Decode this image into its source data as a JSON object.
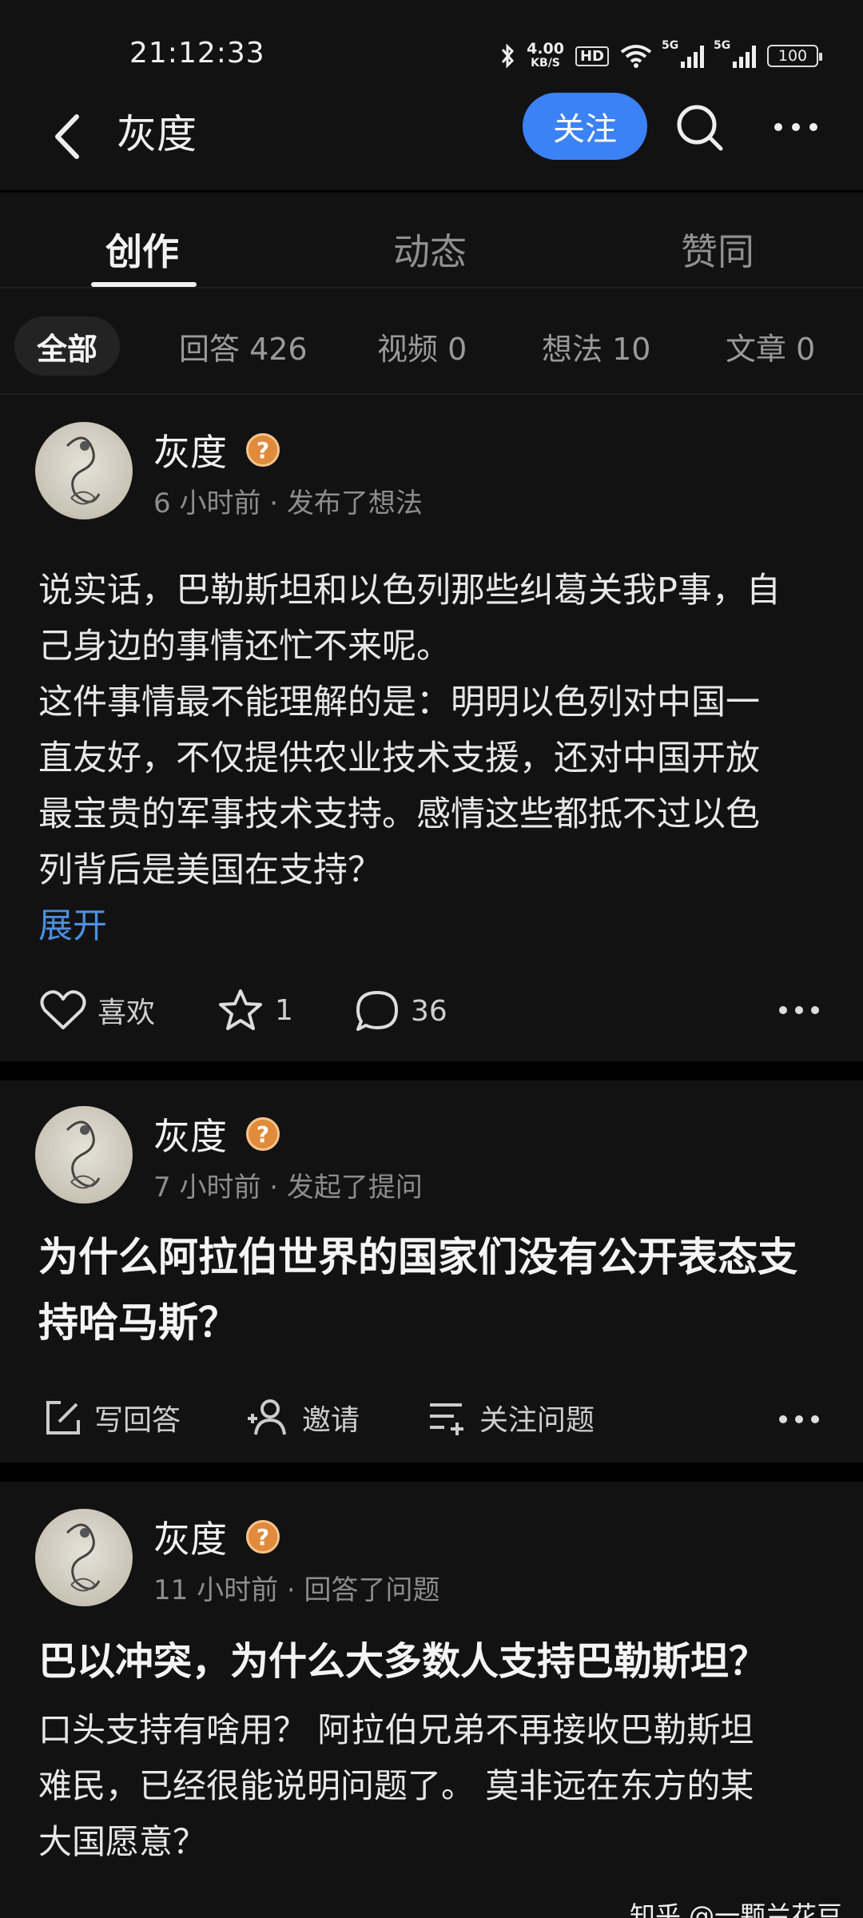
{
  "status_bar": {
    "time": "21:12:33",
    "net_speed_value": "4.00",
    "net_speed_unit": "KB/S",
    "hd_label": "HD",
    "signal1_label": "5G",
    "signal2_label": "5G",
    "battery": "100",
    "icons": [
      "bluetooth-icon",
      "hd-icon",
      "wifi-icon",
      "signal-5g-icon",
      "signal-5g-icon",
      "battery-icon"
    ]
  },
  "header": {
    "title": "灰度",
    "follow_label": "关注",
    "icons": [
      "back-icon",
      "search-icon",
      "more-icon"
    ]
  },
  "tabs": [
    {
      "label": "创作",
      "active": true
    },
    {
      "label": "动态",
      "active": false
    },
    {
      "label": "赞同",
      "active": false
    }
  ],
  "filters": [
    {
      "label": "全部",
      "active": true
    },
    {
      "label": "回答 426",
      "active": false
    },
    {
      "label": "视频 0",
      "active": false
    },
    {
      "label": "想法 10",
      "active": false
    },
    {
      "label": "文章 0",
      "active": false
    }
  ],
  "colors": {
    "accent": "#3b82f6",
    "link": "#4d8fe0",
    "badge": "#e08a3c",
    "background": "#121212"
  },
  "posts": [
    {
      "author": "灰度",
      "badge": "?",
      "meta": "6 小时前 · 发布了想法",
      "text_lines": [
        "说实话，巴勒斯坦和以色列那些纠葛关我P事，自",
        "己身边的事情还忙不来呢。",
        "这件事情最不能理解的是：明明以色列对中国一",
        "直友好，不仅提供农业技术支援，还对中国开放",
        "最宝贵的军事技术支持。感情这些都抵不过以色",
        "列背后是美国在支持？"
      ],
      "expand_label": "展开",
      "actions": {
        "like": "喜欢",
        "favorite": "1",
        "comment": "36"
      }
    },
    {
      "author": "灰度",
      "badge": "?",
      "meta": "7 小时前 · 发起了提问",
      "title_lines": [
        "为什么阿拉伯世界的国家们没有公开表态支",
        "持哈马斯？"
      ],
      "actions": {
        "answer": "写回答",
        "invite": "邀请",
        "follow_question": "关注问题"
      }
    },
    {
      "author": "灰度",
      "badge": "?",
      "meta": "11 小时前 · 回答了问题",
      "title": "巴以冲突，为什么大多数人支持巴勒斯坦？",
      "excerpt_lines": [
        "口头支持有啥用？ 阿拉伯兄弟不再接收巴勒斯坦",
        "难民，已经很能说明问题了。 莫非远在东方的某",
        "大国愿意？"
      ]
    }
  ],
  "watermark": "知乎 @一颗兰花豆"
}
